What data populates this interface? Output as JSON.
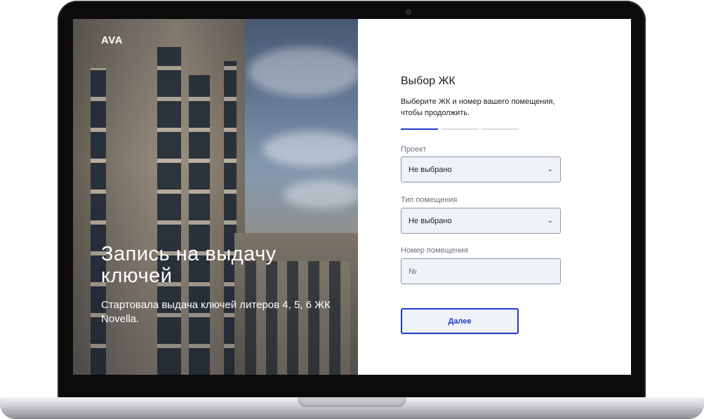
{
  "hero": {
    "logo": "AVA",
    "title": "Запись на выдачу ключей",
    "subtitle": "Стартовала выдача ключей литеров 4, 5, 6 ЖК Novella."
  },
  "form": {
    "title": "Выбор ЖК",
    "description": "Выберите ЖК и номер вашего помещения, чтобы продолжить.",
    "steps": {
      "total": 3,
      "active": 1
    },
    "fields": {
      "project": {
        "label": "Проект",
        "value": "Не выбрано"
      },
      "room_type": {
        "label": "Тип помещения",
        "value": "Не выбрано"
      },
      "room_number": {
        "label": "Номер помещения",
        "placeholder": "№"
      }
    },
    "submit_label": "Далее"
  },
  "icons": {
    "select_chevron": "chevron-down-icon"
  },
  "colors": {
    "accent": "#1f3cc8",
    "field_bg": "#eff2f6",
    "field_border": "#8d95a3"
  }
}
